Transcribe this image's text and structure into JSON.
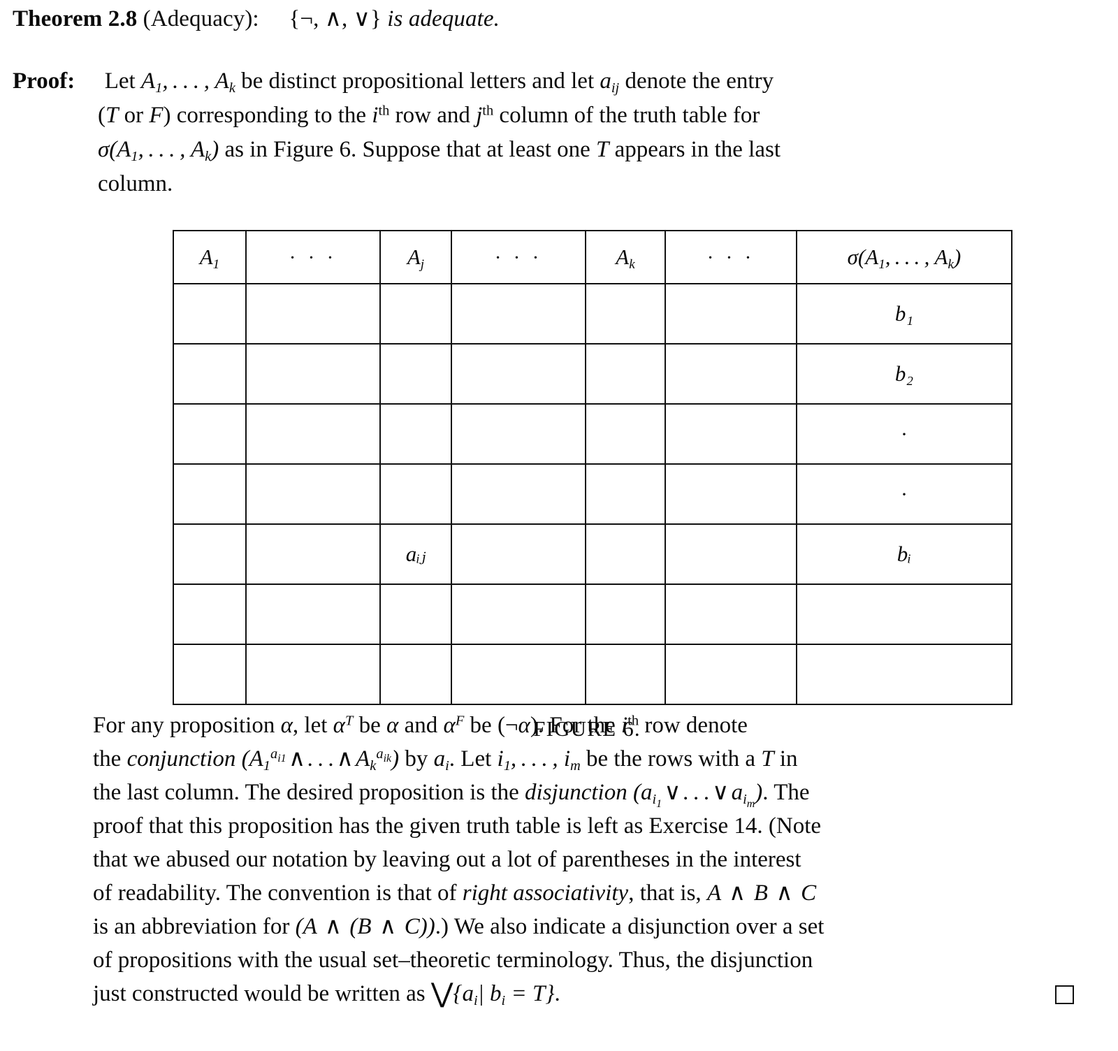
{
  "theorem": {
    "label": "Theorem 2.8",
    "name": "(Adequacy):",
    "statement_set": "{¬, ∧, ∨}",
    "statement_tail": "is adequate."
  },
  "proof": {
    "label": "Proof:",
    "line1_a": "Let",
    "line1_b": "be distinct propositional letters and let",
    "line1_c": "denote the entry",
    "line2_a": "(",
    "line2_T": "T",
    "line2_or": "or",
    "line2_F": "F",
    "line2_b": ") corresponding to the",
    "line2_th1": "th",
    "line2_c": "row and",
    "line2_th2": "th",
    "line2_d": "column of the truth table for",
    "line3_a": "as in Figure 6. Suppose that at least one",
    "line3_T": "T",
    "line3_b": "appears in the last",
    "line4": "column."
  },
  "figure": {
    "caption": "FIGURE 6.",
    "columns": [
      {
        "id": "c0",
        "header": "A",
        "header_sub": "1",
        "type": "var"
      },
      {
        "id": "c1",
        "header": "· · ·",
        "type": "dots"
      },
      {
        "id": "c2",
        "header": "A",
        "header_sub": "j",
        "type": "var"
      },
      {
        "id": "c3",
        "header": "· · ·",
        "type": "dots"
      },
      {
        "id": "c4",
        "header": "A",
        "header_sub": "k",
        "type": "var"
      },
      {
        "id": "c5",
        "header": "· · ·",
        "type": "dots"
      },
      {
        "id": "c6",
        "header": "σ(A₁, … , Aₖ)",
        "type": "formula"
      }
    ],
    "rows": [
      {
        "cells": [
          "",
          "",
          "",
          "",
          "",
          "",
          "b1"
        ]
      },
      {
        "cells": [
          "",
          "",
          "",
          "",
          "",
          "",
          "b2"
        ]
      },
      {
        "cells": [
          "",
          "",
          "",
          "",
          "",
          "",
          "dot"
        ]
      },
      {
        "cells": [
          "",
          "",
          "",
          "",
          "",
          "",
          "dot"
        ]
      },
      {
        "cells": [
          "",
          "",
          "aij",
          "",
          "",
          "",
          "bi"
        ]
      },
      {
        "cells": [
          "",
          "",
          "",
          "",
          "",
          "",
          ""
        ]
      },
      {
        "cells": [
          "",
          "",
          "",
          "",
          "",
          "",
          ""
        ]
      }
    ],
    "cell_labels": {
      "b1": "b₁",
      "b2": "b₂",
      "bi": "bᵢ",
      "aij": "aᵢⱼ",
      "dot": "·"
    }
  },
  "closing": {
    "l1_a": "For any proposition",
    "l1_b": ", let",
    "l1_c": "be",
    "l1_d": "and",
    "l1_e": "be (¬",
    "l1_f": "). For the",
    "l1_th": "th",
    "l1_g": "row denote",
    "l2_a": "the",
    "l2_ital": "conjunction",
    "l2_b": "by",
    "l2_c": ". Let",
    "l2_d": "be the rows with a",
    "l2_T": "T",
    "l2_e": "in",
    "l3_a": "the last column. The desired proposition is the",
    "l3_ital": "disjunction",
    "l3_b": ". The",
    "l4": "proof that this proposition has the given truth table is left as Exercise 14. (Note",
    "l5": "that we abused our notation by leaving out a lot of parentheses in the interest",
    "l6_a": "of readability. The convention is that of",
    "l6_ital": "right associativity",
    "l6_b": ", that is,",
    "l7_a": "is an abbreviation for",
    "l7_b": ".) We also indicate a disjunction over a set",
    "l8": "of propositions with the usual set–theoretic terminology. Thus, the disjunction",
    "l9_a": "just constructed would be written as",
    "l9_b": "."
  }
}
